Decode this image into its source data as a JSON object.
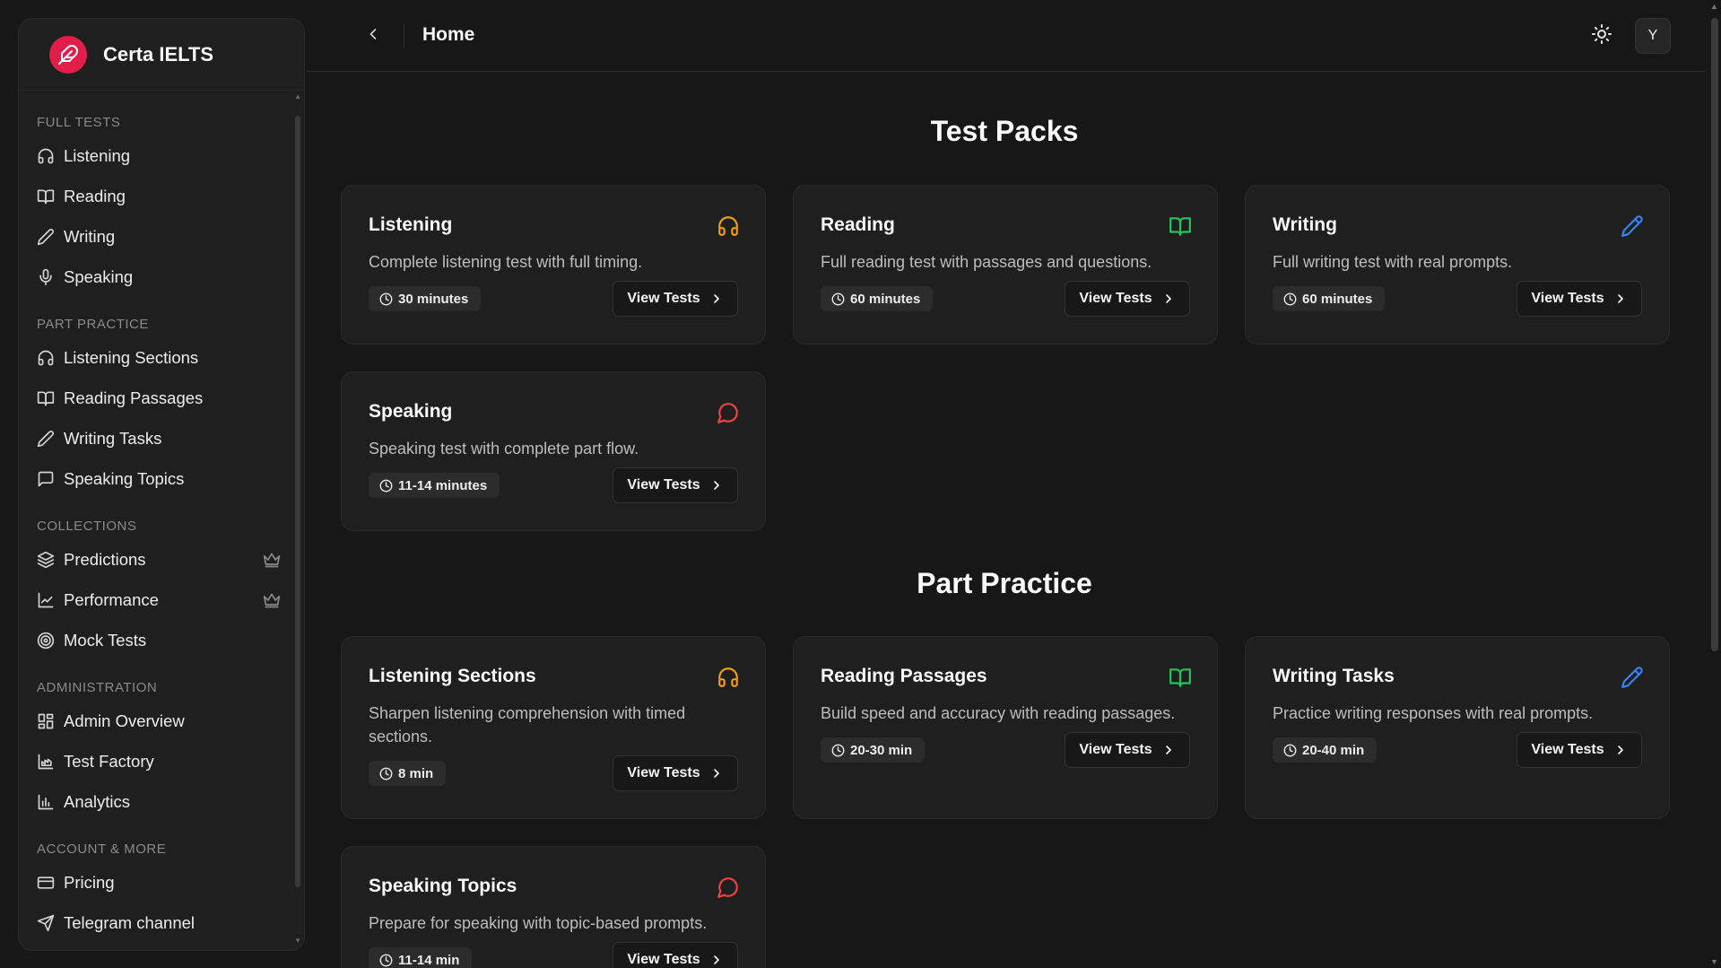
{
  "brand": {
    "name": "Certa IELTS",
    "accent": "#e11d48"
  },
  "header": {
    "title": "Home",
    "avatar_initial": "Y"
  },
  "sidebar": {
    "groups": [
      {
        "label": "FULL TESTS",
        "items": [
          {
            "label": "Listening",
            "icon": "headphones-icon"
          },
          {
            "label": "Reading",
            "icon": "book-icon"
          },
          {
            "label": "Writing",
            "icon": "pencil-icon"
          },
          {
            "label": "Speaking",
            "icon": "mic-icon"
          }
        ]
      },
      {
        "label": "PART PRACTICE",
        "items": [
          {
            "label": "Listening Sections",
            "icon": "headphones-icon"
          },
          {
            "label": "Reading Passages",
            "icon": "book-icon"
          },
          {
            "label": "Writing Tasks",
            "icon": "pencil-icon"
          },
          {
            "label": "Speaking Topics",
            "icon": "chat-icon"
          }
        ]
      },
      {
        "label": "COLLECTIONS",
        "items": [
          {
            "label": "Predictions",
            "icon": "layers-icon",
            "premium": true
          },
          {
            "label": "Performance",
            "icon": "line-chart-icon",
            "premium": true
          },
          {
            "label": "Mock Tests",
            "icon": "target-icon"
          }
        ]
      },
      {
        "label": "ADMINISTRATION",
        "items": [
          {
            "label": "Admin Overview",
            "icon": "grid-icon"
          },
          {
            "label": "Test Factory",
            "icon": "factory-icon"
          },
          {
            "label": "Analytics",
            "icon": "bar-chart-icon"
          }
        ]
      },
      {
        "label": "ACCOUNT & MORE",
        "items": [
          {
            "label": "Pricing",
            "icon": "credit-card-icon"
          },
          {
            "label": "Telegram channel",
            "icon": "send-icon"
          }
        ]
      }
    ]
  },
  "sections": {
    "test_packs": {
      "title": "Test Packs",
      "cards": [
        {
          "title": "Listening",
          "desc": "Complete listening test with full timing.",
          "duration": "30 minutes",
          "button": "View Tests",
          "icon": "headphones-icon",
          "color": "#f59e0b"
        },
        {
          "title": "Reading",
          "desc": "Full reading test with passages and questions.",
          "duration": "60 minutes",
          "button": "View Tests",
          "icon": "book-icon",
          "color": "#22c55e"
        },
        {
          "title": "Writing",
          "desc": "Full writing test with real prompts.",
          "duration": "60 minutes",
          "button": "View Tests",
          "icon": "pencil-icon",
          "color": "#3b82f6"
        },
        {
          "title": "Speaking",
          "desc": "Speaking test with complete part flow.",
          "duration": "11-14 minutes",
          "button": "View Tests",
          "icon": "chat-icon",
          "color": "#ef4444"
        }
      ]
    },
    "part_practice": {
      "title": "Part Practice",
      "cards": [
        {
          "title": "Listening Sections",
          "desc": "Sharpen listening comprehension with timed sections.",
          "duration": "8 min",
          "button": "View Tests",
          "icon": "headphones-icon",
          "color": "#f59e0b"
        },
        {
          "title": "Reading Passages",
          "desc": "Build speed and accuracy with reading passages.",
          "duration": "20-30 min",
          "button": "View Tests",
          "icon": "book-icon",
          "color": "#22c55e"
        },
        {
          "title": "Writing Tasks",
          "desc": "Practice writing responses with real prompts.",
          "duration": "20-40 min",
          "button": "View Tests",
          "icon": "pencil-icon",
          "color": "#3b82f6"
        },
        {
          "title": "Speaking Topics",
          "desc": "Prepare for speaking with topic-based prompts.",
          "duration": "11-14 min",
          "button": "View Tests",
          "icon": "chat-icon",
          "color": "#ef4444"
        }
      ]
    }
  }
}
